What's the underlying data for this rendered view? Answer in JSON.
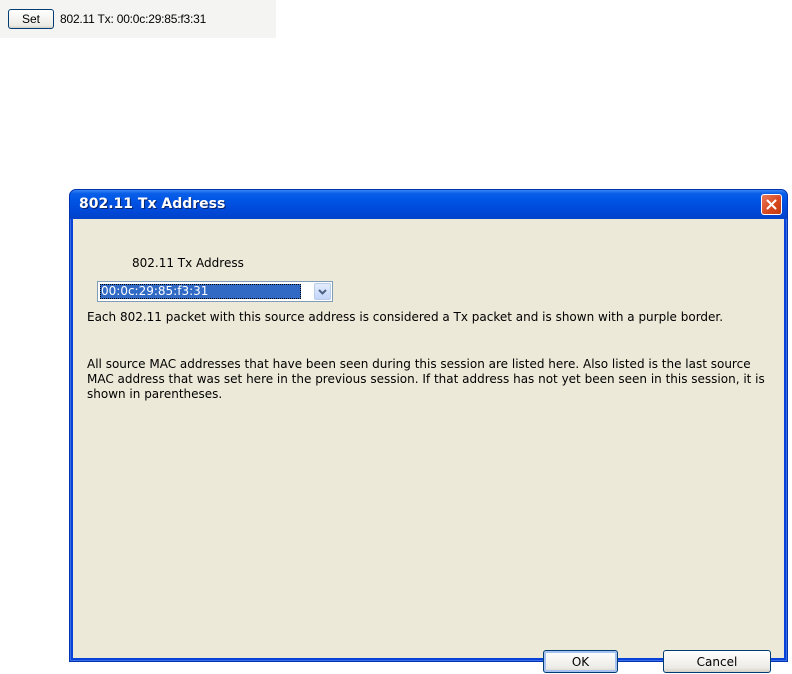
{
  "topbar": {
    "set_label": "Set",
    "tx_status": "802.11 Tx: 00:0c:29:85:f3:31"
  },
  "dialog": {
    "title": "802.11 Tx Address",
    "close_icon": "close-icon",
    "field_label": "802.11 Tx Address",
    "combo_value": "00:0c:29:85:f3:31",
    "paragraph1": "Each 802.11 packet with this source address is considered a Tx packet and is shown with a purple border.",
    "paragraph2": "All source MAC addresses that have been seen during this session are listed here.  Also listed is the last source MAC address that was set here in the previous session.  If that address has not yet been seen in this session, it is shown in parentheses.",
    "ok_label": "OK",
    "cancel_label": "Cancel"
  },
  "colors": {
    "titlebar": "#0055e5",
    "client_bg": "#ece9d8",
    "selection": "#316ac5",
    "close_button": "#d6461c"
  }
}
